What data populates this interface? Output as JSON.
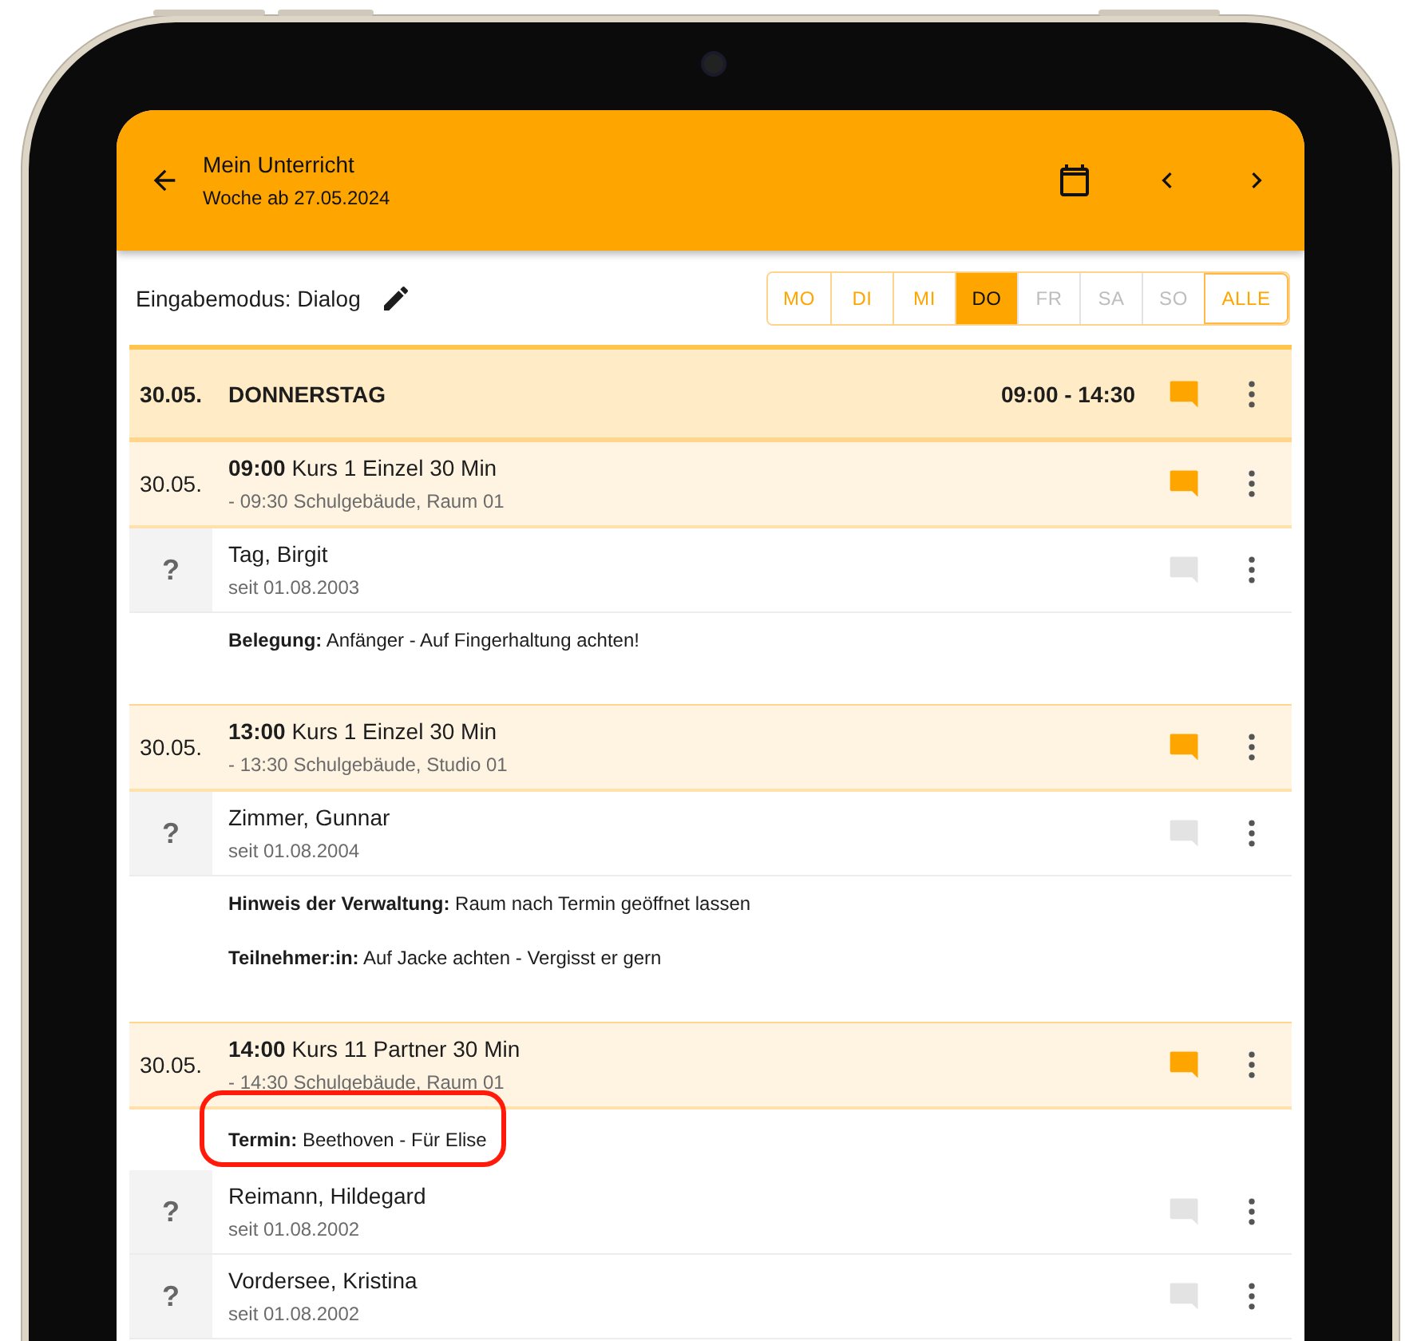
{
  "app_bar": {
    "title": "Mein Unterricht",
    "subtitle": "Woche ab 27.05.2024"
  },
  "mode_label": "Eingabemodus: Dialog",
  "days": [
    {
      "label": "MO",
      "selected": false,
      "disabled": false
    },
    {
      "label": "DI",
      "selected": false,
      "disabled": false
    },
    {
      "label": "MI",
      "selected": false,
      "disabled": false
    },
    {
      "label": "DO",
      "selected": true,
      "disabled": false
    },
    {
      "label": "FR",
      "selected": false,
      "disabled": true
    },
    {
      "label": "SA",
      "selected": false,
      "disabled": true
    },
    {
      "label": "SO",
      "selected": false,
      "disabled": true
    },
    {
      "label": "ALLE",
      "selected": false,
      "disabled": false
    }
  ],
  "day_header": {
    "date": "30.05.",
    "weekday": "DONNERSTAG",
    "time_range": "09:00 - 14:30",
    "comment": true
  },
  "events": [
    {
      "date": "30.05.",
      "title": "**09:00** Kurs 1 Einzel 30 Min",
      "location": "- 09:30 Schulgebäude, Raum 01",
      "comment": true,
      "participants": [
        {
          "avatar": "?",
          "name": "Tag, Birgit",
          "since": "seit 01.08.2003",
          "comment": false,
          "notes": [
            "**Belegung:** Anfänger - Auf Fingerhaltung achten!"
          ]
        }
      ]
    },
    {
      "date": "30.05.",
      "title": "**13:00** Kurs 1 Einzel 30 Min",
      "location": "- 13:30 Schulgebäude, Studio 01",
      "comment": true,
      "participants": [
        {
          "avatar": "?",
          "name": "Zimmer, Gunnar",
          "since": "seit 01.08.2004",
          "comment": false,
          "notes": [
            "**Hinweis der Verwaltung:** Raum nach Termin geöffnet lassen",
            "**Teilnehmer:in:** Auf Jacke achten - Vergisst er gern"
          ]
        }
      ]
    },
    {
      "date": "30.05.",
      "title": "**14:00** Kurs 11 Partner 30 Min",
      "location": "- 14:30 Schulgebäude, Raum 01",
      "comment": true,
      "notes": [
        "**Termin:** Beethoven - Für Elise"
      ],
      "highlight": {
        "kind": "rounded-rect"
      },
      "participants": [
        {
          "avatar": "?",
          "name": "Reimann, Hildegard",
          "since": "seit 01.08.2002",
          "comment": false
        },
        {
          "avatar": "?",
          "name": "Vordersee, Kristina",
          "since": "seit 01.08.2002",
          "comment": false
        }
      ]
    }
  ]
}
